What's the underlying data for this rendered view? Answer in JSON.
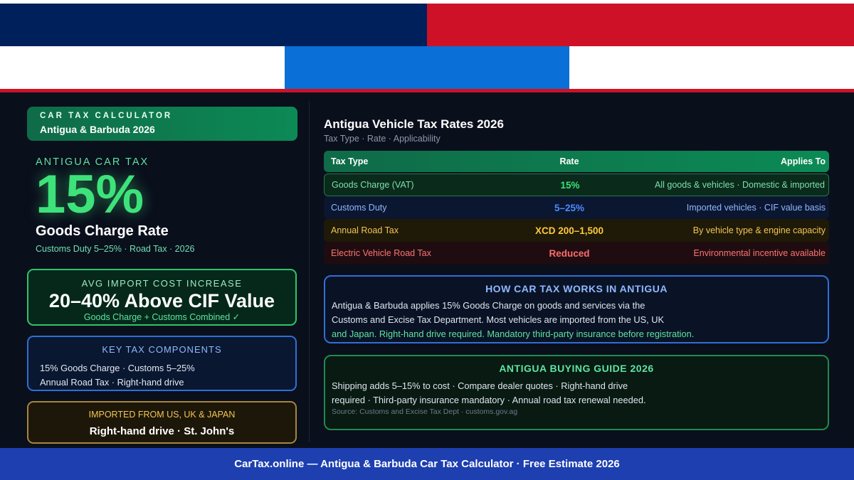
{
  "flag": {
    "colors": {
      "top_left": "#00205b",
      "top_right": "#ce1126",
      "middle": "#0a6fd6",
      "stripe": "#ce1126"
    }
  },
  "brand": {
    "label": "CAR TAX CALCULATOR",
    "subtitle": "Antigua & Barbuda 2026"
  },
  "hero": {
    "eyebrow": "ANTIGUA CAR TAX",
    "rate": "15%",
    "rate_label": "Goods Charge Rate",
    "sub": "Customs Duty 5–25% · Road Tax · 2026"
  },
  "import_cost": {
    "label": "AVG IMPORT COST INCREASE",
    "value": "20–40% Above CIF Value",
    "note": "Goods Charge + Customs Combined ✓"
  },
  "components": {
    "title": "KEY TAX COMPONENTS",
    "line1": "15% Goods Charge · Customs 5–25%",
    "line2": "Annual Road Tax · Right-hand drive"
  },
  "origin": {
    "label": "IMPORTED FROM US, UK & JAPAN",
    "value": "Right-hand drive · St. John's"
  },
  "rates_section": {
    "title": "Antigua Vehicle Tax Rates 2026",
    "subtitle": "Tax Type · Rate · Applicability",
    "headers": {
      "type": "Tax Type",
      "rate": "Rate",
      "applies": "Applies To"
    },
    "rows": [
      {
        "type": "Goods Charge (VAT)",
        "rate": "15%",
        "applies": "All goods & vehicles · Domestic & imported"
      },
      {
        "type": "Customs Duty",
        "rate": "5–25%",
        "applies": "Imported vehicles · CIF value basis"
      },
      {
        "type": "Annual Road Tax",
        "rate": "XCD 200–1,500",
        "applies": "By vehicle type & engine capacity"
      },
      {
        "type": "Electric Vehicle Road Tax",
        "rate": "Reduced",
        "applies": "Environmental incentive available"
      }
    ]
  },
  "how": {
    "title": "HOW CAR TAX WORKS IN ANTIGUA",
    "line1": "Antigua & Barbuda applies 15% Goods Charge on goods and services via the",
    "line2": "Customs and Excise Tax Department. Most vehicles are imported from the US, UK",
    "line3": "and Japan. Right-hand drive required. Mandatory third-party insurance before registration."
  },
  "guide": {
    "title": "ANTIGUA BUYING GUIDE 2026",
    "line1": "Shipping adds 5–15% to cost · Compare dealer quotes · Right-hand drive",
    "line2": "required · Third-party insurance mandatory · Annual road tax renewal needed.",
    "source": "Source: Customs and Excise Tax Dept · customs.gov.ag"
  },
  "footer": {
    "text": "CarTax.online — Antigua & Barbuda Car Tax Calculator · Free Estimate 2026"
  }
}
